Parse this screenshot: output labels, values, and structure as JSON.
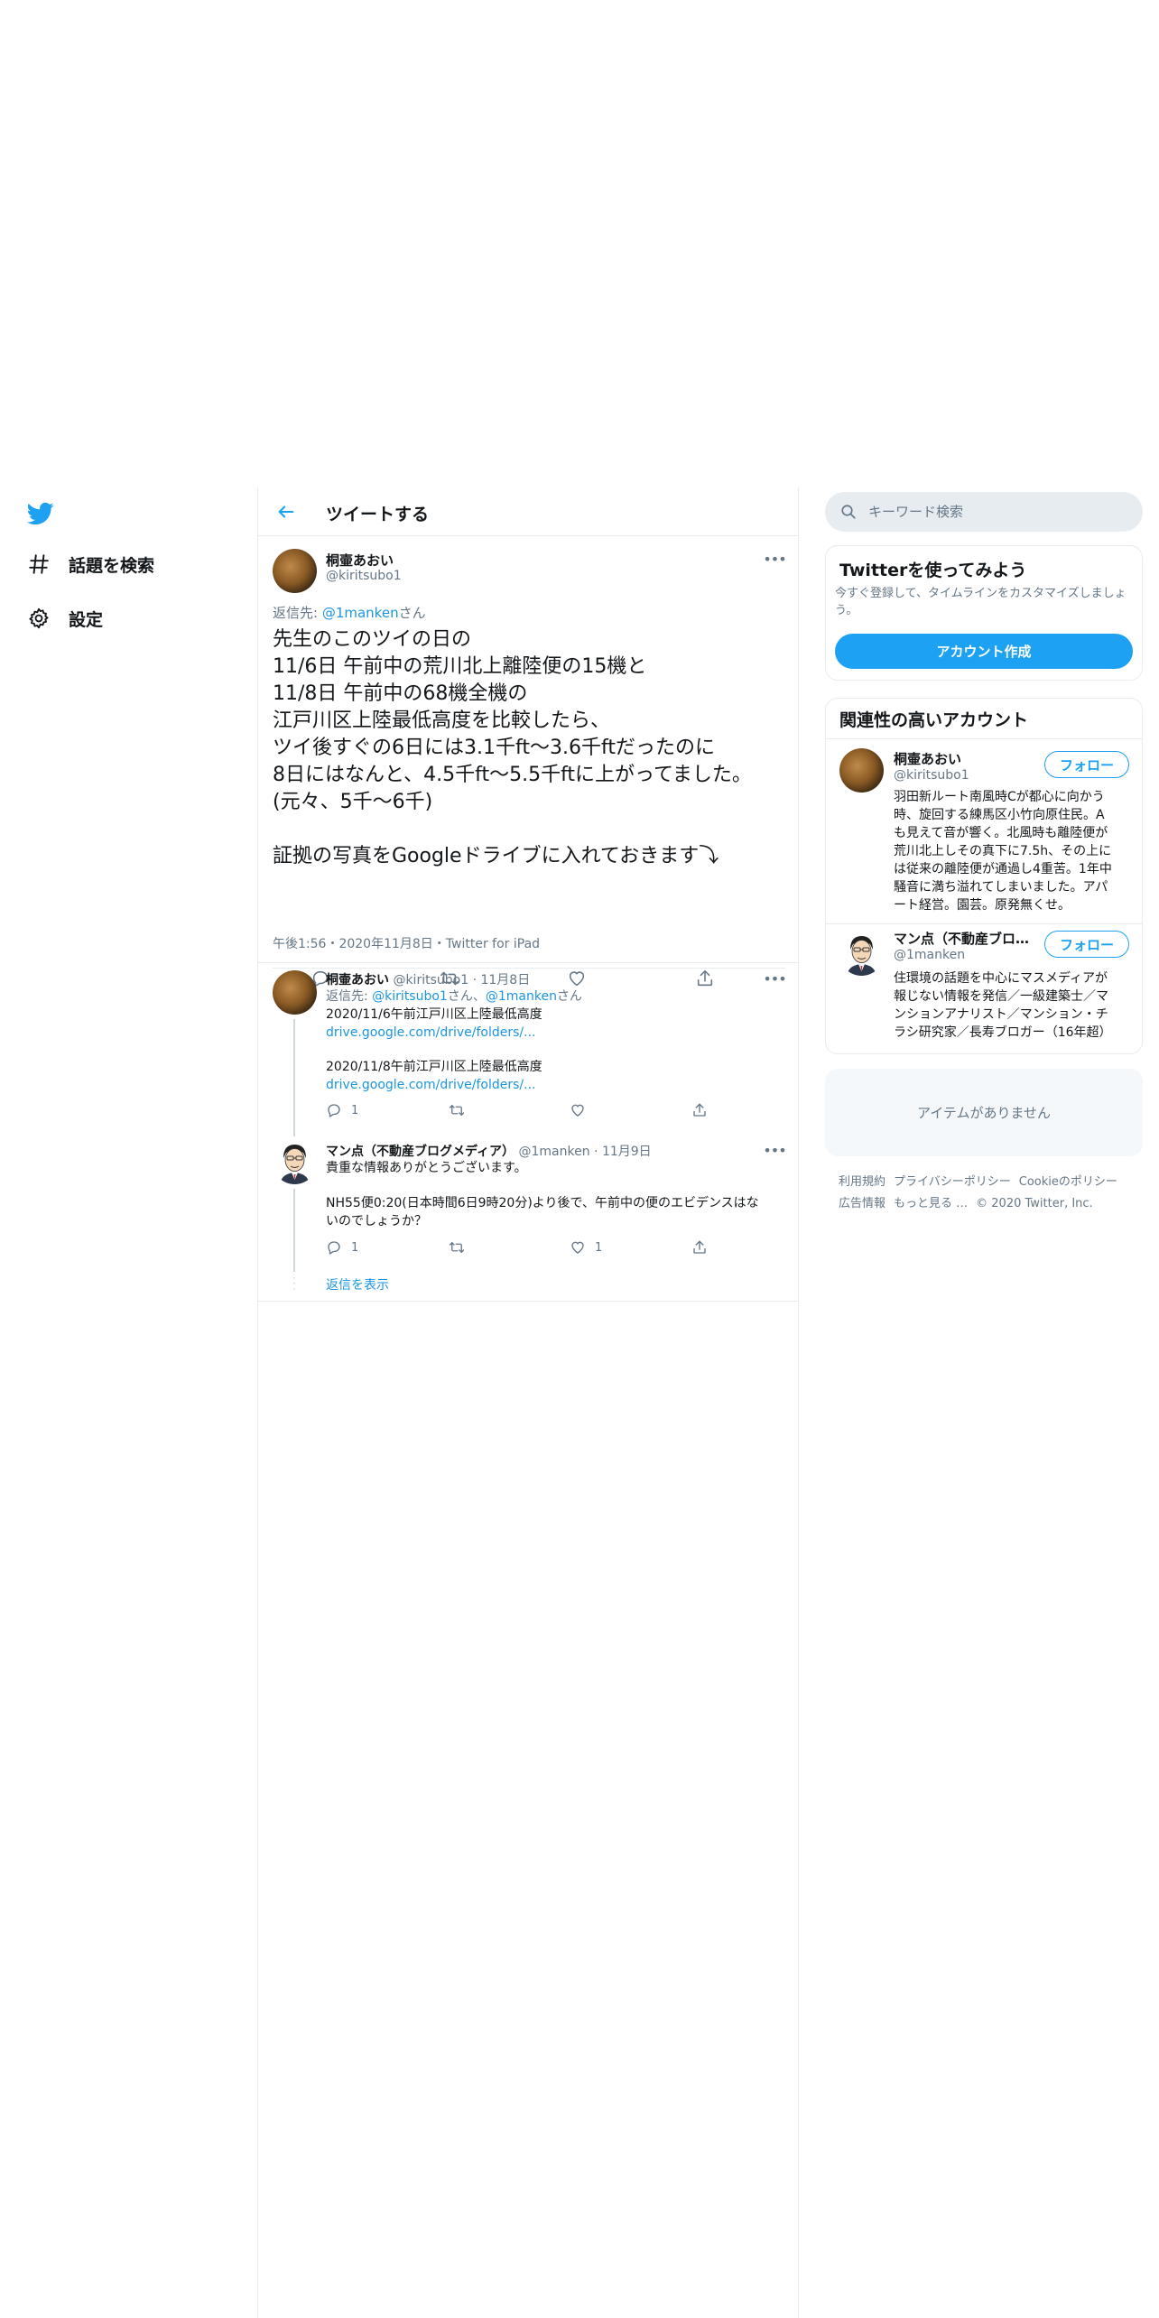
{
  "nav": {
    "items": [
      {
        "label": "話題を検索",
        "icon": "hashtag-icon"
      },
      {
        "label": "設定",
        "icon": "gear-icon"
      }
    ]
  },
  "header": {
    "title": "ツイートする"
  },
  "main_tweet": {
    "name": "桐壷あおい",
    "handle": "@kiritsubo1",
    "reply_prefix": "返信先: ",
    "reply_mention": "@1manken",
    "reply_suffix": "さん",
    "text": "先生のこのツイの日の\n11/6日 午前中の荒川北上離陸便の15機と\n11/8日 午前中の68機全機の\n江戸川区上陸最低高度を比較したら、\nツイ後すぐの6日には3.1千ft～3.6千ftだったのに\n8日にはなんと、4.5千ft～5.5千ftに上がってました。\n(元々、5千～6千)\n\n証拠の写真をGoogleドライブに入れておきます⤵",
    "meta": "午後1:56・2020年11月8日・Twitter for iPad"
  },
  "replies": [
    {
      "name": "桐壷あおい",
      "handle": "@kiritsubo1",
      "date": "11月8日",
      "reply_prefix": "返信先: ",
      "reply_mention1": "@kiritsubo1",
      "reply_mid": "さん、",
      "reply_mention2": "@1manken",
      "reply_suffix": "さん",
      "line1": "2020/11/6午前江戸川区上陸最低高度",
      "link1": "drive.google.com/drive/folders/...",
      "line2": "2020/11/8午前江戸川区上陸最低高度",
      "link2": "drive.google.com/drive/folders/...",
      "reply_count": "1",
      "retweet_count": "",
      "like_count": ""
    },
    {
      "name": "マン点（不動産ブログメディア）",
      "handle": "@1manken",
      "date": "11月9日",
      "line1": "貴重な情報ありがとうございます。",
      "line2": "NH55便0:20(日本時間6日9時20分)より後で、午前中の便のエビデンスはな",
      "line3": "いのでしょうか？",
      "reply_count": "1",
      "retweet_count": "",
      "like_count": "1"
    }
  ],
  "show_replies": "返信を表示",
  "search": {
    "placeholder": "キーワード検索"
  },
  "signup": {
    "title": "Twitterを使ってみよう",
    "desc": "今すぐ登録して、タイムラインをカスタマイズしましょう。",
    "button": "アカウント作成"
  },
  "relevant": {
    "title": "関連性の高いアカウント",
    "follow_label": "フォロー",
    "accounts": [
      {
        "name": "桐壷あおい",
        "handle": "@kiritsubo1",
        "bio": "羽田新ルート南風時Cが都心に向かう\n時、旋回する練馬区小竹向原住民。A\nも見えて音が響く。北風時も離陸便が\n荒川北上しその真下に7.5h、その上に\nは従来の離陸便が通過し4重苦。1年中\n騒音に満ち溢れてしまいました。アパ\nート経営。園芸。原発無くせ。"
      },
      {
        "name": "マン点（不動産ブログメディア）",
        "handle": "@1manken",
        "bio": "住環境の話題を中心にマスメディアが\n報じない情報を発信／一級建築士／マ\nンションアナリスト／マンション・チ\nラシ研究家／長寿ブロガー（16年超）"
      }
    ]
  },
  "empty": {
    "text": "アイテムがありません"
  },
  "footer": {
    "links": [
      "利用規約",
      "プライバシーポリシー",
      "Cookieのポリシー",
      "広告情報",
      "もっと見る …"
    ],
    "copyright": "© 2020 Twitter, Inc."
  },
  "colors": {
    "accent": "#1da1f2",
    "link": "#1b95e0",
    "muted": "#657786",
    "border": "#e6ecf0"
  }
}
